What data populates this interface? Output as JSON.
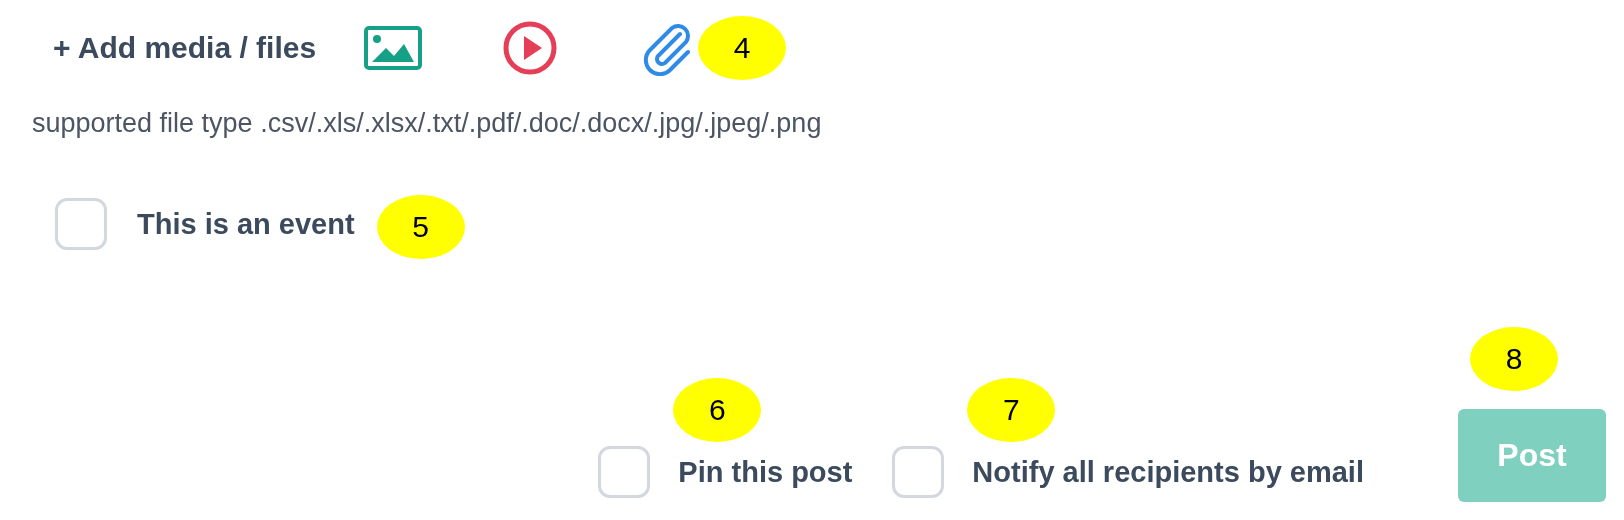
{
  "media": {
    "label": "+ Add media / files",
    "marker": "4"
  },
  "supported_types": "supported file type .csv/.xls/.xlsx/.txt/.pdf/.doc/.docx/.jpg/.jpeg/.png",
  "event_option": {
    "label": "This is an event",
    "checked": false,
    "marker": "5"
  },
  "footer_options": [
    {
      "label": "Pin this post",
      "checked": false,
      "marker": "6"
    },
    {
      "label": "Notify all recipients by email",
      "checked": false,
      "marker": "7"
    }
  ],
  "post_button": {
    "label": "Post",
    "disabled": true,
    "marker": "8"
  }
}
